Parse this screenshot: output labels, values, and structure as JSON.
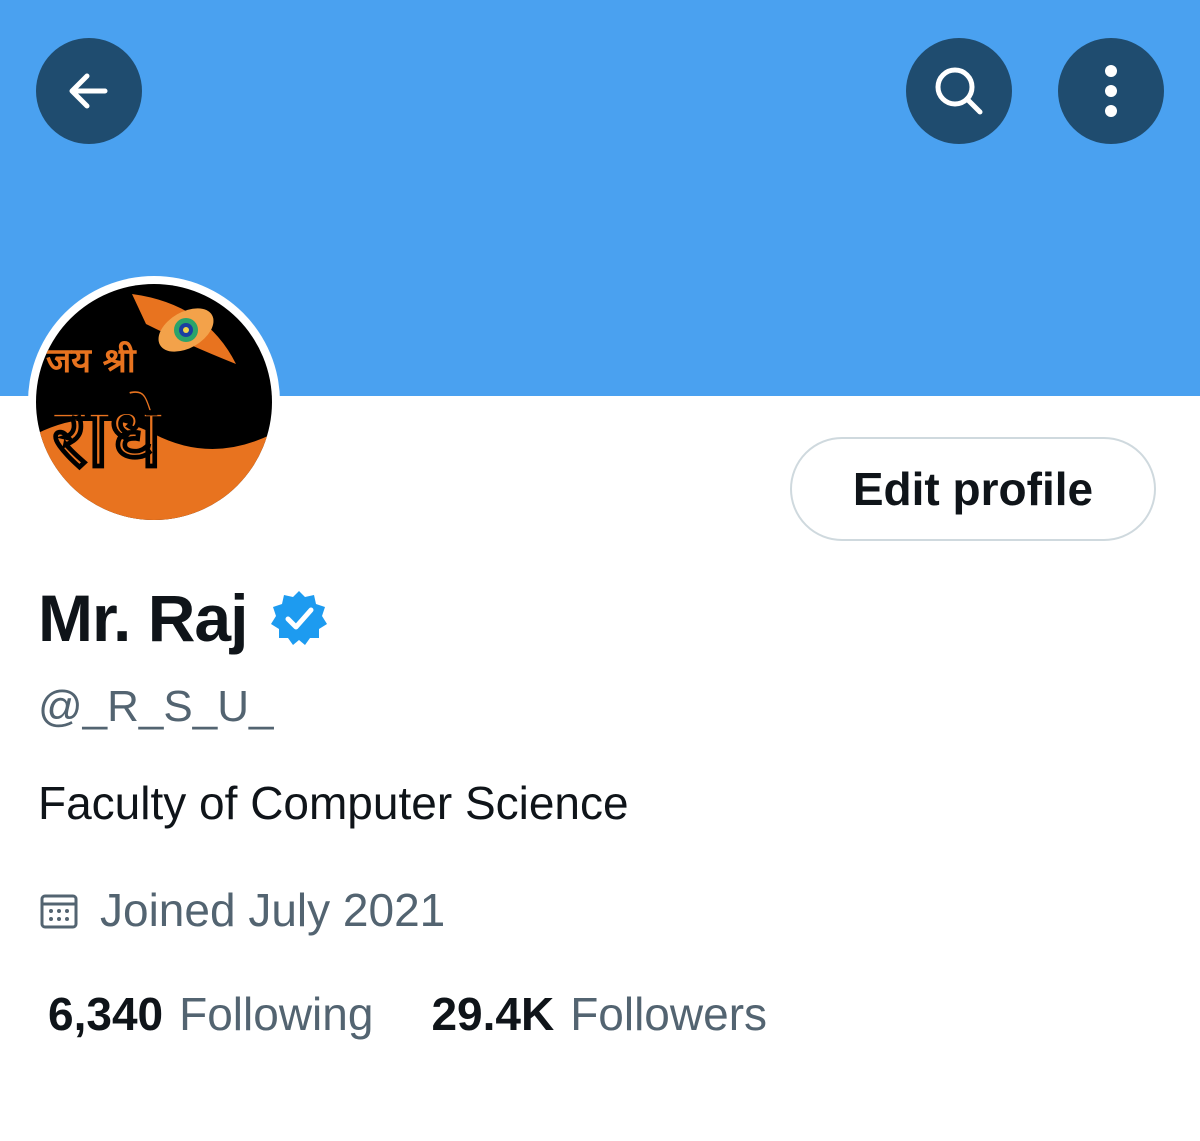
{
  "profile": {
    "display_name": "Mr. Raj",
    "handle": "@_R_S_U_",
    "bio": "Faculty of Computer Science",
    "joined": "Joined July 2021",
    "verified": true,
    "avatar_text_top": "जय श्री",
    "avatar_text_main": "राधे"
  },
  "actions": {
    "edit_profile_label": "Edit profile"
  },
  "stats": {
    "following_count": "6,340",
    "following_label": "Following",
    "followers_count": "29.4K",
    "followers_label": "Followers"
  },
  "icons": {
    "back": "arrow-left-icon",
    "search": "search-icon",
    "more": "more-vertical-icon",
    "verified": "verified-badge-icon",
    "calendar": "calendar-icon"
  },
  "colors": {
    "banner": "#4aa1f0",
    "header_button": "#1f4c6f",
    "verified": "#1d9bf0",
    "text_primary": "#0f1419",
    "text_secondary": "#536471",
    "avatar_orange": "#e8731f",
    "avatar_black": "#000000"
  }
}
